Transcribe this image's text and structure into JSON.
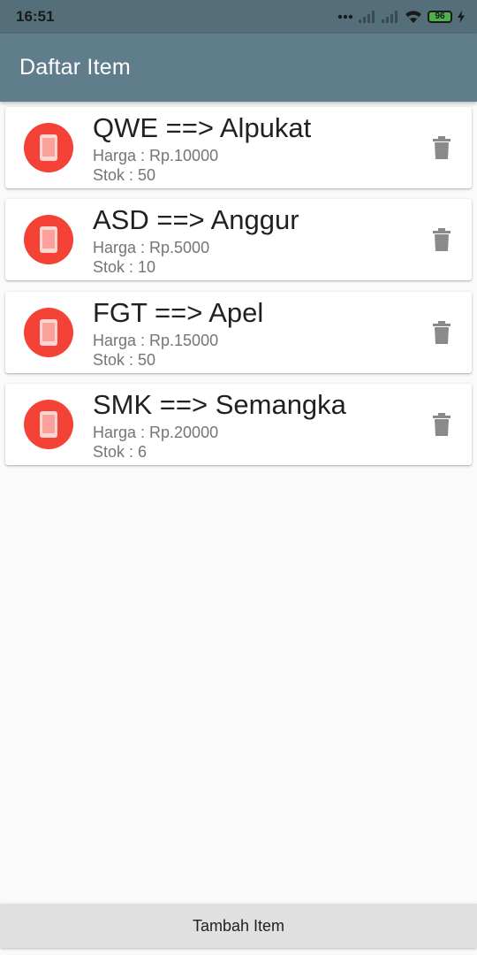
{
  "status_bar": {
    "time": "16:51",
    "battery": "96",
    "icons": [
      "dots-icon",
      "signal-icon",
      "signal-icon",
      "wifi-icon",
      "battery-icon",
      "charging-icon"
    ]
  },
  "app_bar": {
    "title": "Daftar Item"
  },
  "items": [
    {
      "title": "QWE ==> Alpukat",
      "price": "Harga : Rp.10000",
      "stock": "Stok : 50"
    },
    {
      "title": "ASD ==> Anggur",
      "price": "Harga : Rp.5000",
      "stock": "Stok : 10"
    },
    {
      "title": "FGT ==> Apel",
      "price": "Harga : Rp.15000",
      "stock": "Stok : 50"
    },
    {
      "title": "SMK ==> Semangka",
      "price": "Harga : Rp.20000",
      "stock": "Stok : 6"
    }
  ],
  "item_icon": "phone-icon",
  "delete_icon": "trash-icon",
  "bottom_button": {
    "label": "Tambah Item"
  },
  "colors": {
    "status_bar": "#546e7a",
    "app_bar": "#607d8b",
    "avatar": "#f44336",
    "delete_icon": "#8a8a8a",
    "button_bg": "#e0e0e0"
  }
}
